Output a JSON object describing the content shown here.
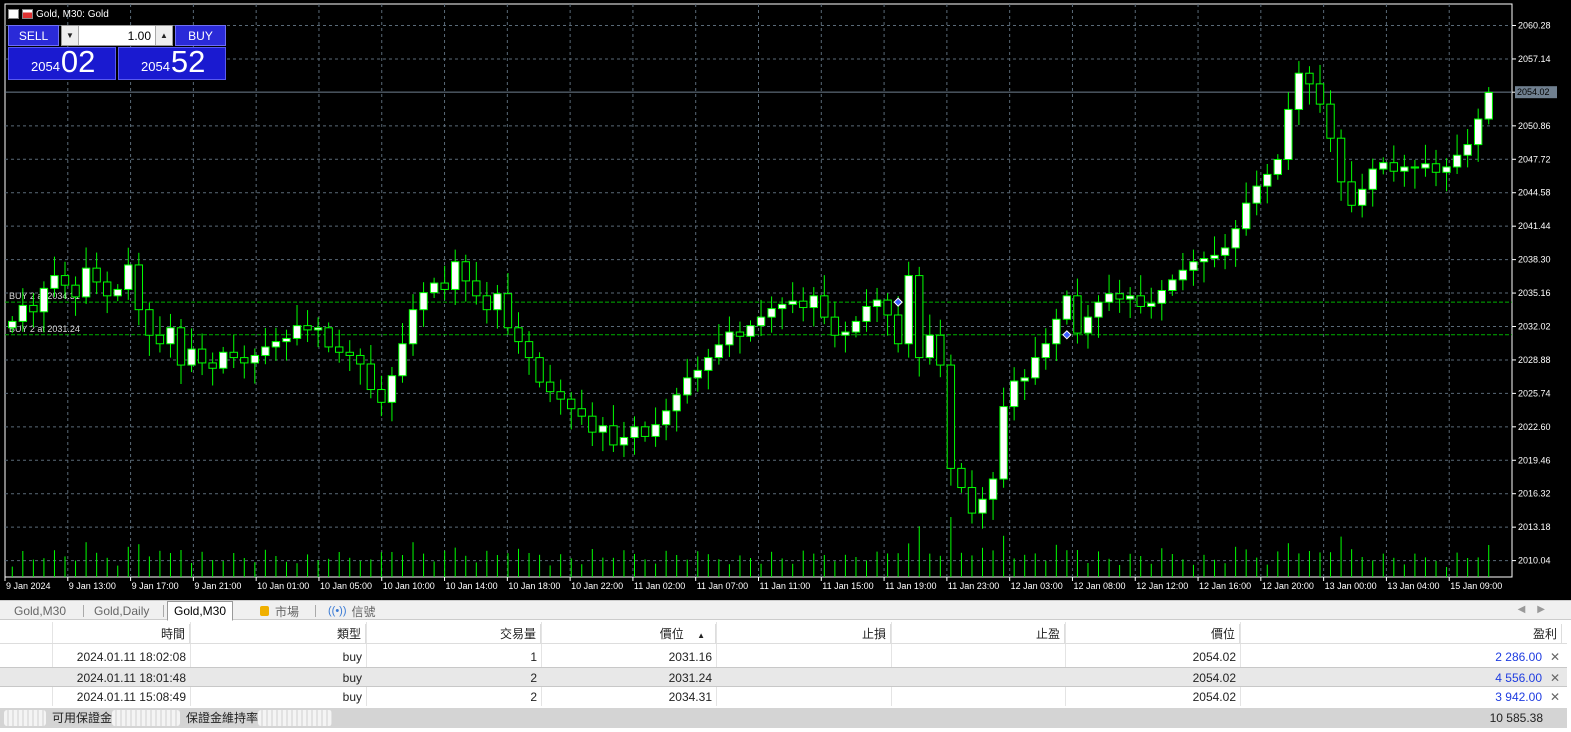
{
  "window": {
    "title": "Gold, M30: Gold"
  },
  "trade_panel": {
    "sell_label": "SELL",
    "buy_label": "BUY",
    "lot": "1.00",
    "sell_small": "2054",
    "sell_big": "02",
    "buy_small": "2054",
    "buy_big": "52"
  },
  "chart": {
    "price_labels": [
      "2060.28",
      "2057.14",
      "2054.02",
      "2050.86",
      "2047.72",
      "2044.58",
      "2041.44",
      "2038.30",
      "2035.16",
      "2032.02",
      "2028.88",
      "2025.74",
      "2022.60",
      "2019.46",
      "2016.32",
      "2013.18",
      "2010.04"
    ],
    "current_price": "2054.02",
    "time_labels": [
      "9 Jan 2024",
      "9 Jan 13:00",
      "9 Jan 17:00",
      "9 Jan 21:00",
      "10 Jan 01:00",
      "10 Jan 05:00",
      "10 Jan 10:00",
      "10 Jan 14:00",
      "10 Jan 18:00",
      "10 Jan 22:00",
      "11 Jan 02:00",
      "11 Jan 07:00",
      "11 Jan 11:00",
      "11 Jan 15:00",
      "11 Jan 19:00",
      "11 Jan 23:00",
      "12 Jan 03:00",
      "12 Jan 08:00",
      "12 Jan 12:00",
      "12 Jan 16:00",
      "12 Jan 20:00",
      "13 Jan 00:00",
      "13 Jan 04:00",
      "15 Jan 09:00"
    ],
    "order_lines": [
      {
        "label": "BUY 2 at 2034.31",
        "price": 2034.31
      },
      {
        "label": "BUY 2 at 2031.24",
        "price": 2031.24
      }
    ],
    "colors": {
      "background": "#000000",
      "candle": "#00ff00",
      "bull_body": "#ffffff",
      "grid": "#5a6a78",
      "order_line": "#00b000",
      "bid_line": "#708090"
    }
  },
  "chart_data": {
    "type": "candlestick",
    "ylim": [
      2008.5,
      2062.3
    ],
    "close": [
      2032.5,
      2034.0,
      2033.4,
      2035.6,
      2036.8,
      2035.9,
      2034.8,
      2037.5,
      2036.2,
      2034.9,
      2035.5,
      2037.8,
      2033.6,
      2031.2,
      2030.4,
      2031.9,
      2028.4,
      2029.9,
      2028.6,
      2028.1,
      2029.6,
      2029.1,
      2028.6,
      2029.3,
      2030.1,
      2030.6,
      2030.9,
      2032.1,
      2031.7,
      2031.9,
      2030.1,
      2029.6,
      2029.3,
      2028.5,
      2026.1,
      2024.9,
      2027.4,
      2030.4,
      2033.6,
      2035.2,
      2036.1,
      2035.5,
      2038.1,
      2036.3,
      2034.9,
      2033.6,
      2035.1,
      2031.9,
      2030.6,
      2029.1,
      2026.8,
      2025.9,
      2025.2,
      2024.3,
      2023.6,
      2022.1,
      2022.7,
      2020.9,
      2021.6,
      2022.6,
      2021.7,
      2022.8,
      2024.1,
      2025.6,
      2027.2,
      2027.9,
      2029.1,
      2030.3,
      2031.5,
      2031.1,
      2032.1,
      2032.9,
      2033.7,
      2034.1,
      2034.4,
      2033.8,
      2034.9,
      2032.9,
      2031.2,
      2031.5,
      2032.5,
      2033.9,
      2034.5,
      2033.1,
      2030.4,
      2036.8,
      2029.1,
      2031.2,
      2028.4,
      2018.7,
      2016.9,
      2014.5,
      2015.8,
      2017.7,
      2024.5,
      2026.9,
      2027.2,
      2029.1,
      2030.4,
      2032.7,
      2034.9,
      2031.4,
      2032.9,
      2034.3,
      2035.1,
      2034.6,
      2034.9,
      2033.9,
      2034.2,
      2035.4,
      2036.4,
      2037.3,
      2038.1,
      2038.4,
      2038.7,
      2039.4,
      2041.2,
      2043.6,
      2045.2,
      2046.3,
      2047.7,
      2052.4,
      2055.8,
      2054.8,
      2052.9,
      2049.7,
      2045.6,
      2043.4,
      2044.9,
      2046.8,
      2047.4,
      2046.6,
      2047.0,
      2046.9,
      2047.3,
      2046.5,
      2047.0,
      2048.1,
      2049.1,
      2051.5,
      2054.0
    ],
    "bid": 2054.02
  },
  "tabs": {
    "items": [
      "Gold,M30",
      "Gold,Daily",
      "Gold,M30",
      "市場",
      "信號"
    ],
    "active_index": 2
  },
  "positions": {
    "headers": [
      "時間",
      "類型",
      "交易量",
      "價位",
      "止損",
      "止盈",
      "價位",
      "盈利"
    ],
    "rows": [
      {
        "time": "2024.01.11 18:02:08",
        "type": "buy",
        "volume": "1",
        "open_price": "2031.16",
        "sl": "",
        "tp": "",
        "price": "2054.02",
        "profit": "2 286.00"
      },
      {
        "time": "2024.01.11 18:01:48",
        "type": "buy",
        "volume": "2",
        "open_price": "2031.24",
        "sl": "",
        "tp": "",
        "price": "2054.02",
        "profit": "4 556.00"
      },
      {
        "time": "2024.01.11 15:08:49",
        "type": "buy",
        "volume": "2",
        "open_price": "2034.31",
        "sl": "",
        "tp": "",
        "price": "2054.02",
        "profit": "3 942.00"
      }
    ],
    "summary": {
      "free_margin_label": "可用保證金",
      "margin_level_label": "保證金維持率",
      "total": "10 585.38"
    }
  }
}
